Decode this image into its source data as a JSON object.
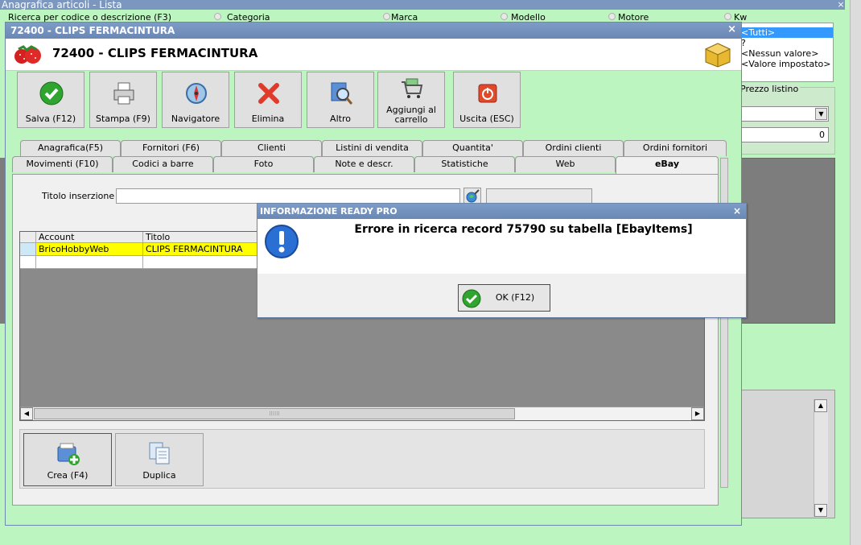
{
  "background_window": {
    "title": "Anagrafica articoli  - Lista",
    "close": "×",
    "search_labels": [
      "Ricerca per codice o descrizione (F3)",
      "Categoria",
      "Marca",
      "Modello",
      "Motore",
      "Kw"
    ],
    "filter_items": [
      "<Tutti>",
      "?",
      "<Nessun valore>",
      "<Valore impostato>"
    ],
    "price_label": "Prezzo listino",
    "price_value": "0"
  },
  "article_window": {
    "title": "72400 - CLIPS FERMACINTURA",
    "heading": "72400 - CLIPS FERMACINTURA",
    "close": "×",
    "toolbar": [
      {
        "label": "Salva (F12)",
        "icon": "check-icon"
      },
      {
        "label": "Stampa (F9)",
        "icon": "printer-icon"
      },
      {
        "label": "Navigatore",
        "icon": "compass-icon"
      },
      {
        "label": "Elimina",
        "icon": "delete-x-icon"
      },
      {
        "label": "Altro",
        "icon": "search-doc-icon"
      },
      {
        "label": "Aggiungi al carrello",
        "icon": "cart-icon"
      },
      {
        "label": "Uscita (ESC)",
        "icon": "power-icon"
      }
    ],
    "tabs_row1": [
      "Anagrafica(F5)",
      "Fornitori (F6)",
      "Clienti",
      "Listini di vendita",
      "Quantita'",
      "Ordini clienti",
      "Ordini fornitori"
    ],
    "tabs_row2": [
      "Movimenti (F10)",
      "Codici a barre",
      "Foto",
      "Note e descr.",
      "Statistiche",
      "Web",
      "eBay"
    ],
    "active_tab": "eBay",
    "ebay": {
      "titolo_label": "Titolo inserzione :",
      "titolo_value": "",
      "grid_columns": [
        "Account",
        "Titolo"
      ],
      "grid_rows": [
        [
          "BricoHobbyWeb",
          "CLIPS FERMACINTURA"
        ]
      ]
    },
    "bottom_buttons": [
      {
        "label": "Crea (F4)",
        "icon": "create-icon"
      },
      {
        "label": "Duplica",
        "icon": "duplicate-icon"
      }
    ]
  },
  "dialog": {
    "title": "INFORMAZIONE READY PRO",
    "close": "×",
    "message": "Errore in ricerca record 75790 su tabella [EbayItems]",
    "ok_label": "OK (F12)"
  },
  "colors": {
    "background_green": "#bdf5c0",
    "titlebar_blue": "#7390be",
    "selection_yellow": "#ffff00",
    "grid_gray": "#8a8a8a"
  }
}
